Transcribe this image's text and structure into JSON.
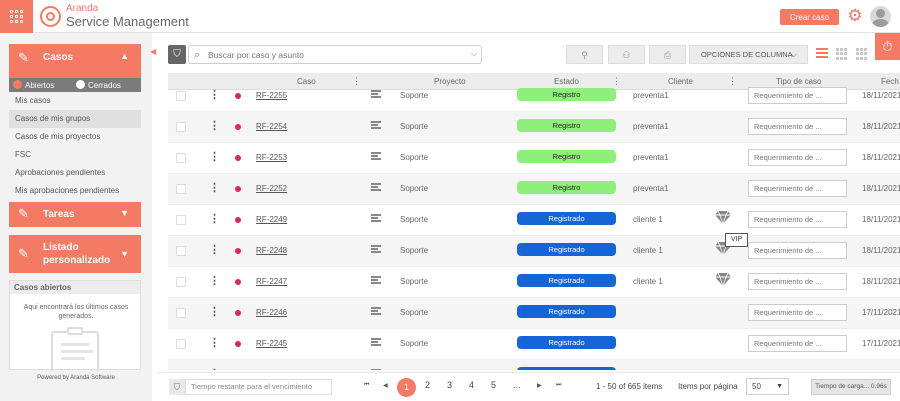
{
  "header": {
    "brand_top": "Aranda",
    "brand_bottom": "Service Management",
    "create_button": "Crear caso",
    "accent_color": "#f47a64"
  },
  "sidebar": {
    "casos_label": "Casos",
    "filter_open": "Abiertos",
    "filter_closed": "Cerrados",
    "items": [
      {
        "label": "Mis casos",
        "selected": false
      },
      {
        "label": "Casos de mis grupos",
        "selected": true
      },
      {
        "label": "Casos de mis proyectos",
        "selected": false
      },
      {
        "label": "FSC",
        "selected": false
      },
      {
        "label": "Aprobaciones pendientes",
        "selected": false
      },
      {
        "label": "Mis aprobaciones pendientes",
        "selected": false
      }
    ],
    "tareas_label": "Tareas",
    "listado_label_1": "Listado",
    "listado_label_2": "personalizado",
    "recent_title": "Casos abiertos",
    "recent_desc": "Aqui encontrará los últimos casos generados.",
    "powered_by": "Powered by Aranda Software"
  },
  "toolbar": {
    "search_placeholder": "Buscar por caso y asunto",
    "columns_button": "OPCIONES DE COLUMNA"
  },
  "table": {
    "headers": {
      "caso": "Caso",
      "proyecto": "Proyecto",
      "estado": "Estado",
      "cliente": "Cliente",
      "tipo": "Tipo de caso",
      "fecha": "Fech"
    },
    "rows": [
      {
        "id": "RF-2255",
        "project": "Soporte",
        "status": "Registro",
        "status_kind": "reg",
        "client": "preventa1",
        "vip": false,
        "type": "Requerimiento de ...",
        "date": "18/11/2021"
      },
      {
        "id": "RF-2254",
        "project": "Soporte",
        "status": "Registro",
        "status_kind": "reg",
        "client": "preventa1",
        "vip": false,
        "type": "Requerimiento de ...",
        "date": "18/11/2021"
      },
      {
        "id": "RF-2253",
        "project": "Soporte",
        "status": "Registro",
        "status_kind": "reg",
        "client": "preventa1",
        "vip": false,
        "type": "Requerimiento de ...",
        "date": "18/11/2021"
      },
      {
        "id": "RF-2252",
        "project": "Soporte",
        "status": "Registro",
        "status_kind": "reg",
        "client": "preventa1",
        "vip": false,
        "type": "Requerimiento de ...",
        "date": "18/11/2021"
      },
      {
        "id": "RF-2249",
        "project": "Soporte",
        "status": "Registrado",
        "status_kind": "regd",
        "client": "cliente 1",
        "vip": true,
        "type": "Requerimiento de ...",
        "date": "18/11/2021"
      },
      {
        "id": "RF-2248",
        "project": "Soporte",
        "status": "Registrado",
        "status_kind": "regd",
        "client": "cliente 1",
        "vip": true,
        "type": "Requerimiento de ...",
        "date": "18/11/2021"
      },
      {
        "id": "RF-2247",
        "project": "Soporte",
        "status": "Registrado",
        "status_kind": "regd",
        "client": "cliente 1",
        "vip": true,
        "type": "Requerimiento de ...",
        "date": "18/11/2021"
      },
      {
        "id": "RF-2246",
        "project": "Soporte",
        "status": "Registrado",
        "status_kind": "regd",
        "client": "",
        "vip": false,
        "type": "Requerimiento de ...",
        "date": "17/11/2021"
      },
      {
        "id": "RF-2245",
        "project": "Soporte",
        "status": "Registrado",
        "status_kind": "regd",
        "client": "",
        "vip": false,
        "type": "Requerimiento de ...",
        "date": "17/11/2021"
      },
      {
        "id": "",
        "project": "",
        "status": "Registrado",
        "status_kind": "regd",
        "client": "",
        "vip": false,
        "type": "",
        "date": ""
      }
    ],
    "tooltip": "VIP"
  },
  "footer": {
    "time_filter_placeholder": "Tiempo restante para el vencimiento",
    "pages": [
      "1",
      "2",
      "3",
      "4",
      "5",
      "..."
    ],
    "range": "1 - 50 of 665 items",
    "items_per_page_label": "Items por página",
    "items_per_page_value": "50",
    "load_time": "Tiempo de carga... 0.96s"
  }
}
